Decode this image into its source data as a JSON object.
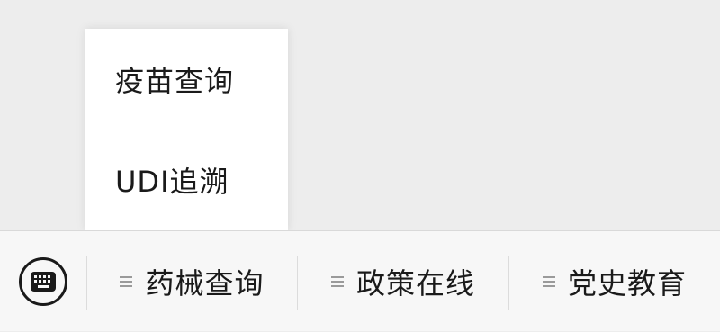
{
  "popup_menu": {
    "items": [
      {
        "label": "疫苗查询"
      },
      {
        "label": "UDI追溯"
      }
    ]
  },
  "bottom_menu": {
    "keyboard_icon": "keyboard-icon",
    "tabs": [
      {
        "label": "药械查询",
        "icon": "hamburger-icon"
      },
      {
        "label": "政策在线",
        "icon": "hamburger-icon"
      },
      {
        "label": "党史教育",
        "icon": "hamburger-icon"
      }
    ]
  }
}
